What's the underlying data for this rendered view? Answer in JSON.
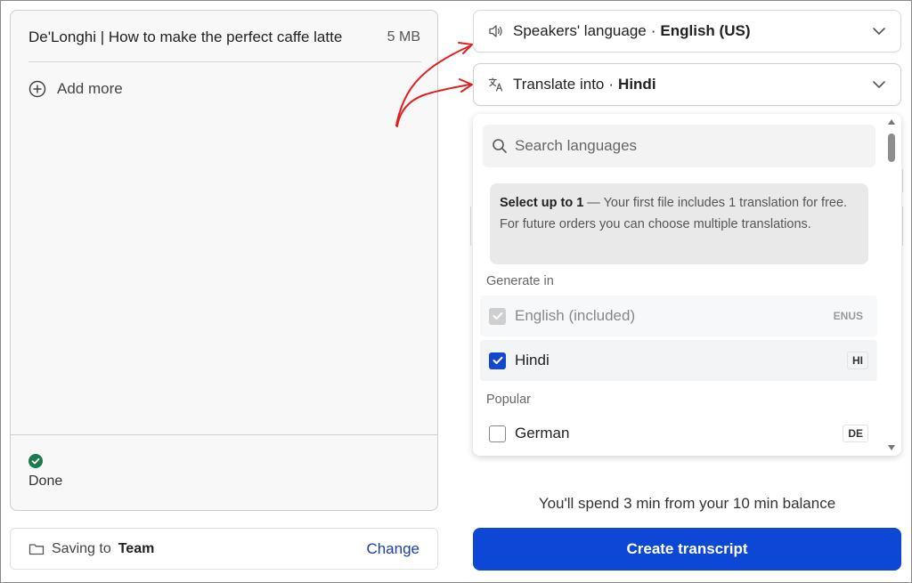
{
  "files": {
    "items": [
      {
        "name": "De'Longhi | How to make the perfect caffe latte",
        "size": "5 MB"
      }
    ],
    "add_more_label": "Add more",
    "status_label": "Done"
  },
  "saving": {
    "label": "Saving to",
    "target": "Team",
    "change_label": "Change"
  },
  "speakers": {
    "label": "Speakers' language",
    "separator": "·",
    "value": "English (US)"
  },
  "translate": {
    "label": "Translate into",
    "separator": "·",
    "value": "Hindi"
  },
  "dropdown": {
    "search_placeholder": "Search languages",
    "info_strong": "Select up to 1",
    "info_text": " — Your first file includes 1 translation for free. For future orders you can choose multiple translations.",
    "groups": {
      "generate_label": "Generate in",
      "popular_label": "Popular"
    },
    "languages": [
      {
        "name": "English (included)",
        "code": "ENUS",
        "state": "disabled"
      },
      {
        "name": "Hindi",
        "code": "HI",
        "state": "checked"
      },
      {
        "name": "German",
        "code": "DE",
        "state": "unchecked"
      }
    ]
  },
  "footer": {
    "spend_text": "You'll spend 3 min from your 10 min balance",
    "create_label": "Create transcript"
  },
  "colors": {
    "primary": "#0d47d6",
    "checkbox_checked": "#1447cf",
    "success": "#1d7a4c",
    "link": "#1b3fa8",
    "annotation": "#e02020"
  }
}
